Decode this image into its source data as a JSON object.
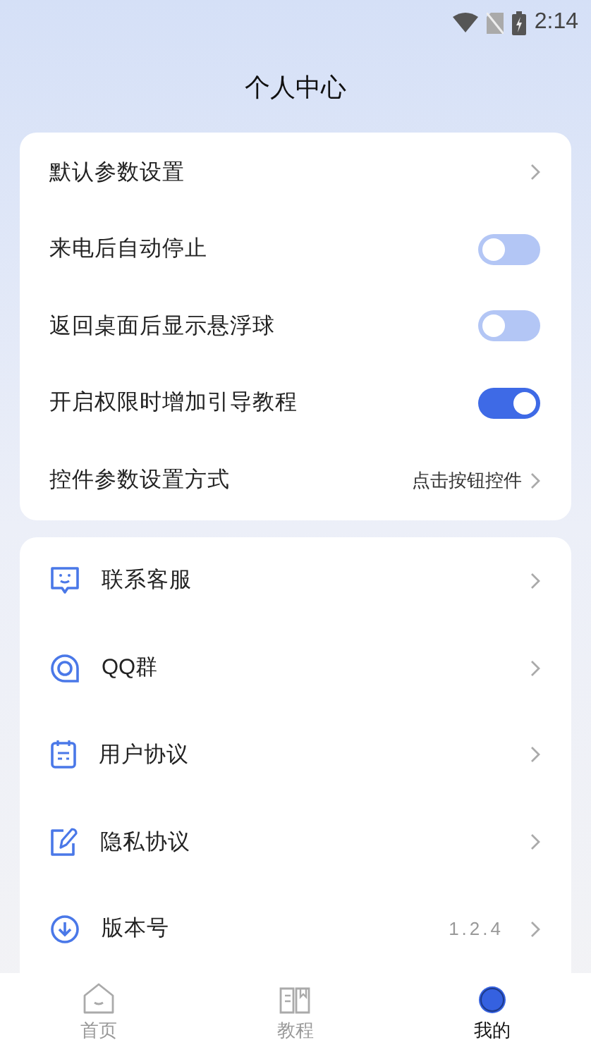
{
  "status_bar": {
    "time": "2:14"
  },
  "title": "个人中心",
  "settings": [
    {
      "kind": "link",
      "label": "默认参数设置"
    },
    {
      "kind": "toggle",
      "label": "来电后自动停止",
      "on": false
    },
    {
      "kind": "toggle",
      "label": "返回桌面后显示悬浮球",
      "on": false
    },
    {
      "kind": "toggle",
      "label": "开启权限时增加引导教程",
      "on": true
    },
    {
      "kind": "link",
      "label": "控件参数设置方式",
      "value": "点击按钮控件"
    }
  ],
  "menu": [
    {
      "kind": "chat",
      "label": "联系客服"
    },
    {
      "kind": "qq",
      "label": "QQ群"
    },
    {
      "kind": "doc",
      "label": "用户协议"
    },
    {
      "kind": "edit",
      "label": "隐私协议"
    },
    {
      "kind": "download",
      "label": "版本号",
      "value": "1.2.4"
    }
  ],
  "tabs": [
    {
      "kind": "home",
      "label": "首页",
      "selected": false
    },
    {
      "kind": "book",
      "label": "教程",
      "selected": false
    },
    {
      "kind": "me",
      "label": "我的",
      "selected": true
    }
  ]
}
